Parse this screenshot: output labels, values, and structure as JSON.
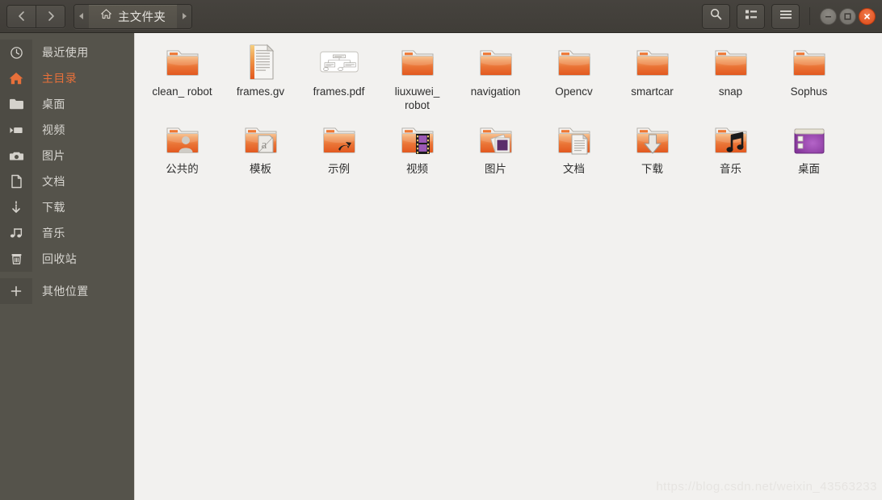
{
  "window": {
    "title": "主文件夹",
    "controls": {
      "minimize": "minimize",
      "maximize": "maximize",
      "close": "close"
    }
  },
  "header": {
    "back_label": "后退",
    "forward_label": "前进",
    "path_prev_label": "上一级路径",
    "path_next_label": "下一级路径",
    "breadcrumb": "主文件夹",
    "search_label": "搜索",
    "view_toggle_label": "视图切换",
    "menu_label": "菜单"
  },
  "sidebar": {
    "items": [
      {
        "label": "最近使用",
        "icon": "clock-icon",
        "selected": false
      },
      {
        "label": "主目录",
        "icon": "home-icon",
        "selected": true
      },
      {
        "label": "桌面",
        "icon": "folder-icon",
        "selected": false
      },
      {
        "label": "视频",
        "icon": "video-icon",
        "selected": false
      },
      {
        "label": "图片",
        "icon": "camera-icon",
        "selected": false
      },
      {
        "label": "文档",
        "icon": "document-icon",
        "selected": false
      },
      {
        "label": "下载",
        "icon": "download-icon",
        "selected": false
      },
      {
        "label": "音乐",
        "icon": "music-icon",
        "selected": false
      },
      {
        "label": "回收站",
        "icon": "trash-icon",
        "selected": false
      },
      {
        "label": "其他位置",
        "icon": "plus-icon",
        "selected": false
      }
    ]
  },
  "files": {
    "row1": [
      {
        "name": "clean_\nrobot",
        "label": "clean_ robot",
        "icon": "folder-plain"
      },
      {
        "name": "frames.gv",
        "label": "frames.gv",
        "icon": "text-document"
      },
      {
        "name": "frames.pdf",
        "label": "frames.pdf",
        "icon": "pdf-thumbnail"
      },
      {
        "name": "liuxuwei_\nrobot",
        "label": "liuxuwei_ robot",
        "icon": "folder-plain"
      },
      {
        "name": "navigation",
        "label": "navigation",
        "icon": "folder-plain"
      },
      {
        "name": "Opencv",
        "label": "Opencv",
        "icon": "folder-plain"
      },
      {
        "name": "smartcar",
        "label": "smartcar",
        "icon": "folder-plain"
      },
      {
        "name": "snap",
        "label": "snap",
        "icon": "folder-plain"
      },
      {
        "name": "Sophus",
        "label": "Sophus",
        "icon": "folder-plain"
      }
    ],
    "row2": [
      {
        "name": "公共的",
        "label": "公共的",
        "icon": "folder-publicshare"
      },
      {
        "name": "模板",
        "label": "模板",
        "icon": "folder-templates"
      },
      {
        "name": "示例",
        "label": "示例",
        "icon": "folder-examples"
      },
      {
        "name": "视频",
        "label": "视频",
        "icon": "folder-videos"
      },
      {
        "name": "图片",
        "label": "图片",
        "icon": "folder-pictures"
      },
      {
        "name": "文档",
        "label": "文档",
        "icon": "folder-documents"
      },
      {
        "name": "下载",
        "label": "下载",
        "icon": "folder-downloads"
      },
      {
        "name": "音乐",
        "label": "音乐",
        "icon": "folder-music"
      },
      {
        "name": "桌面",
        "label": "桌面",
        "icon": "desktop-window"
      }
    ]
  },
  "watermark": "https://blog.csdn.net/weixin_43563233",
  "colors": {
    "headerbar": "#46433e",
    "sidebar": "#55534b",
    "sidebar_icon_column": "#4d4b44",
    "selected_text": "#e8703a",
    "content_bg": "#f2f1ef",
    "folder_orange": "#e2571e",
    "close_button": "#dd4814"
  }
}
